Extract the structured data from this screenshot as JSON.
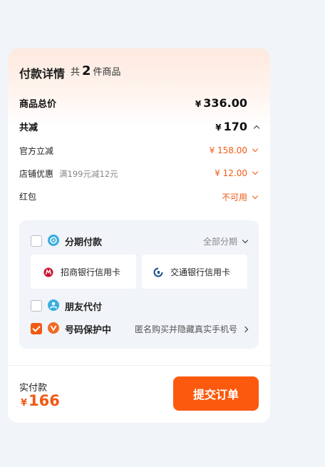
{
  "header": {
    "title": "付款详情",
    "count_prefix": "共",
    "count": "2",
    "count_suffix": "件商品"
  },
  "summary": {
    "total_label": "商品总价",
    "total_currency": "¥",
    "total_value": "336.00",
    "discount_label": "共减",
    "discount_currency": "¥",
    "discount_value": "170"
  },
  "discounts": [
    {
      "label": "官方立减",
      "note": "",
      "value": "¥ 158.00"
    },
    {
      "label": "店铺优惠",
      "note": "满199元减12元",
      "value": "¥ 12.00"
    },
    {
      "label": "红包",
      "note": "",
      "value": "不可用"
    }
  ],
  "payment": {
    "installment_label": "分期付款",
    "installment_action": "全部分期",
    "banks": [
      "招商银行信用卡",
      "交通银行信用卡"
    ],
    "friend_pay_label": "朋友代付",
    "privacy_label": "号码保护中",
    "privacy_desc": "匿名购买并隐藏真实手机号",
    "privacy_checked": true
  },
  "footer": {
    "paid_label": "实付款",
    "paid_currency": "¥",
    "paid_value": "166",
    "submit_label": "提交订单"
  },
  "colors": {
    "accent": "#f05a14",
    "button": "#fb5a0e",
    "panel_bg": "#f1f4f8",
    "installment_icon": "#3aaee0",
    "friend_icon": "#3aaee0",
    "privacy_icon": "#f06a23"
  },
  "icons": {
    "cmb": "cmb-bank-icon",
    "bocom": "bocom-bank-icon"
  }
}
